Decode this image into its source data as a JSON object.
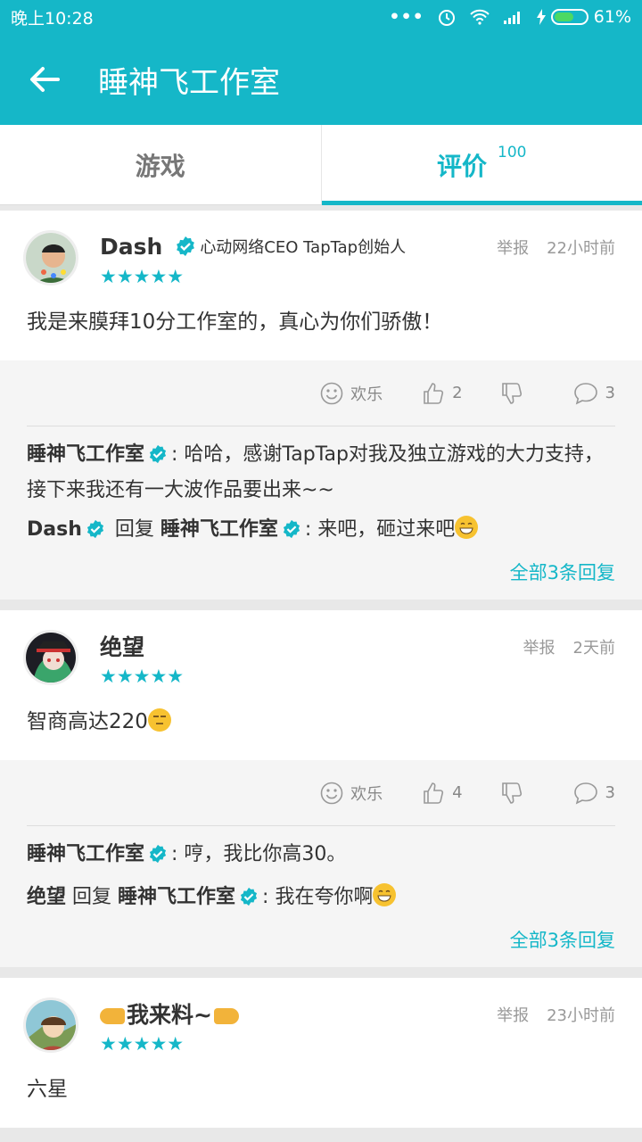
{
  "status_bar": {
    "time": "晚上10:28",
    "dots": "•••",
    "battery": "61%"
  },
  "app_bar": {
    "title": "睡神飞工作室"
  },
  "tabs": [
    {
      "label": "游戏",
      "active": false
    },
    {
      "label": "评价",
      "count": "100",
      "active": true
    }
  ],
  "reviews": [
    {
      "author": "Dash",
      "author_tag": "心动网络CEO TapTap创始人",
      "report": "举报",
      "time": "22小时前",
      "stars": "★★★★★",
      "text": "我是来膜拜10分工作室的，真心为你们骄傲！",
      "joy_label": "欢乐",
      "likes": "2",
      "comments": "3",
      "replies": [
        {
          "name": "睡神飞工作室",
          "text": ": 哈哈，感谢TapTap对我及独立游戏的大力支持，接下来我还有一大波作品要出来~~"
        },
        {
          "name": "Dash",
          "reply_word": "回复",
          "to": "睡神飞工作室",
          "text": ": 来吧，砸过来吧"
        }
      ],
      "all_replies": "全部3条回复"
    },
    {
      "author": "绝望",
      "report": "举报",
      "time": "2天前",
      "stars": "★★★★★",
      "text": "智商高达220",
      "joy_label": "欢乐",
      "likes": "4",
      "comments": "3",
      "replies": [
        {
          "name": "睡神飞工作室",
          "text": ": 哼，我比你高30。"
        },
        {
          "name": "绝望",
          "reply_word": "回复",
          "to": "睡神飞工作室",
          "text": ": 我在夸你啊"
        }
      ],
      "all_replies": "全部3条回复"
    },
    {
      "author": "我来料~",
      "report": "举报",
      "time": "23小时前",
      "stars": "★★★★★",
      "text": "六星"
    }
  ],
  "colors": {
    "primary": "#15b7c8",
    "emoji": "#f7c230"
  },
  "icons": [
    "back-arrow-icon",
    "verified-icon",
    "smile-icon",
    "thumb-up-icon",
    "thumb-down-icon",
    "comment-icon",
    "alarm-icon",
    "wifi-icon",
    "signal-icon",
    "battery-icon"
  ]
}
